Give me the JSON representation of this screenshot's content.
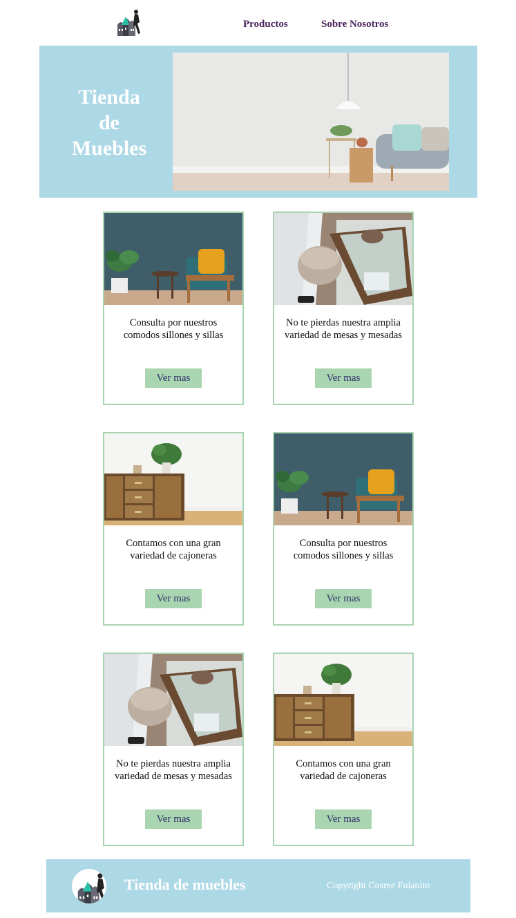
{
  "header": {
    "logo_icon": "furniture-store-logo",
    "nav": [
      {
        "label": "Productos"
      },
      {
        "label": "Sobre Nosotros"
      }
    ]
  },
  "hero": {
    "title_line1": "Tienda",
    "title_line2": "de",
    "title_line3": "Muebles",
    "background": "#add8e6",
    "image": "living-room-sofa-lamp-image"
  },
  "cards": [
    {
      "text": "Consulta por nuestros comodos sillones y sillas",
      "button": "Ver mas",
      "image": "armchair-room-image"
    },
    {
      "text": "No te pierdas nuestra amplia variedad de mesas y mesadas",
      "button": "Ver mas",
      "image": "pallet-table-bedroom-image"
    },
    {
      "text": "Contamos con una gran variedad de cajoneras",
      "button": "Ver mas",
      "image": "wooden-sideboard-image"
    },
    {
      "text": "Consulta por nuestros comodos sillones y sillas",
      "button": "Ver mas",
      "image": "armchair-room-image"
    },
    {
      "text": "No te pierdas nuestra amplia variedad de mesas y mesadas",
      "button": "Ver mas",
      "image": "pallet-table-bedroom-image"
    },
    {
      "text": "Contamos con una gran variedad de cajoneras",
      "button": "Ver mas",
      "image": "wooden-sideboard-image"
    }
  ],
  "footer": {
    "title": "Tienda de muebles",
    "copyright": "Copyright Cosme Fulanito",
    "logo_icon": "furniture-store-logo"
  },
  "colors": {
    "accent": "#add8e6",
    "card_border": "#a8d5b0",
    "button_bg": "#a9d6b0",
    "nav_text": "#4a235a"
  }
}
